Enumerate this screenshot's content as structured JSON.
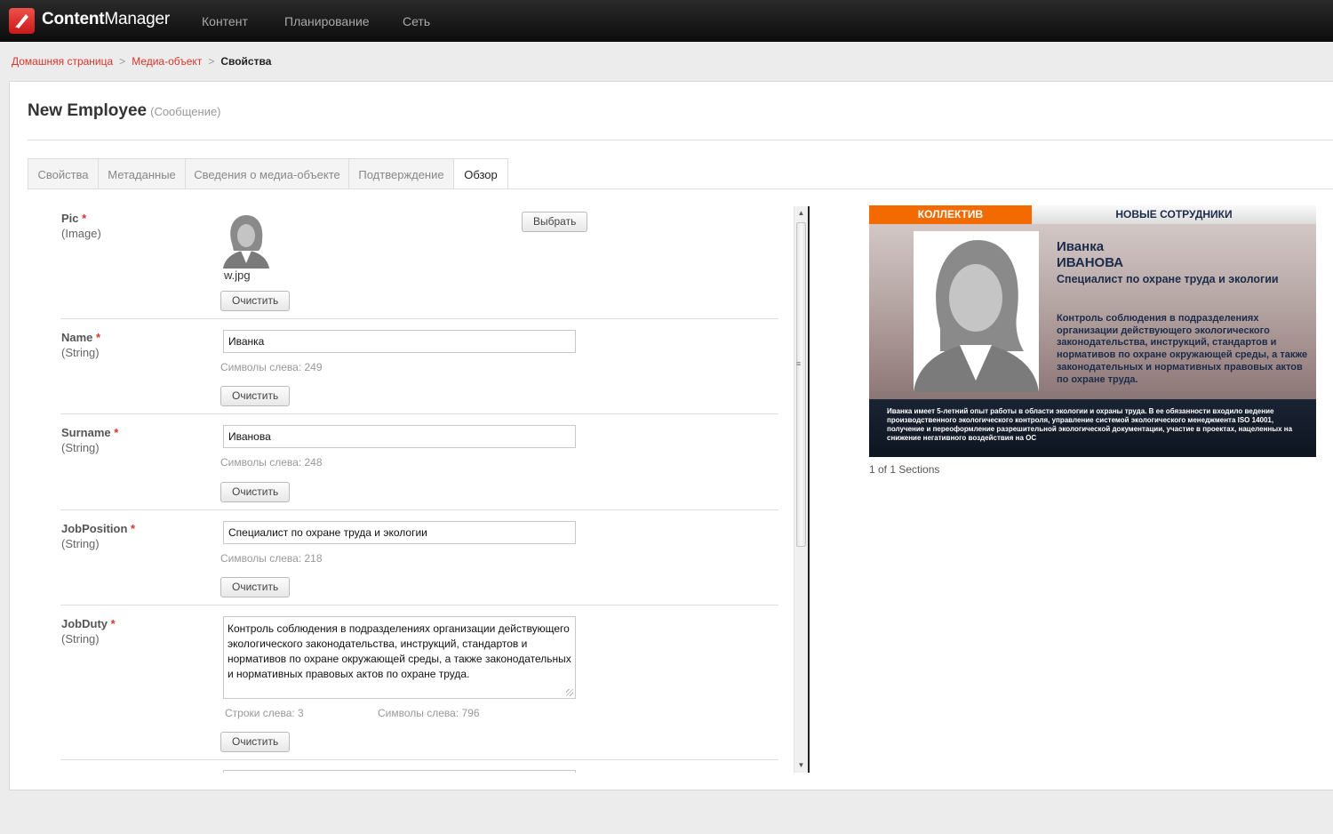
{
  "app": {
    "brand_main": "Content",
    "brand_rest": "Manager"
  },
  "nav": [
    {
      "label": "Контент"
    },
    {
      "label": "Планирование"
    },
    {
      "label": "Сеть"
    }
  ],
  "breadcrumb": {
    "home": "Домашняя страница",
    "media": "Медиа-объект",
    "current": "Свойства",
    "separator": ">"
  },
  "page": {
    "title": "New Employee",
    "subtitle": "(Сообщение)"
  },
  "tabs": [
    {
      "label": "Свойства",
      "active": false
    },
    {
      "label": "Метаданные",
      "active": false
    },
    {
      "label": "Сведения о медиа-объекте",
      "active": false
    },
    {
      "label": "Подтверждение",
      "active": false
    },
    {
      "label": "Обзор",
      "active": true
    }
  ],
  "form": {
    "required_mark": "*",
    "clear_label": "Очистить",
    "pic": {
      "name": "Pic",
      "type": "(Image)",
      "file": "w.jpg",
      "choose_label": "Выбрать",
      "avatar_icon": "person-silhouette-icon"
    },
    "name": {
      "name": "Name",
      "type": "(String)",
      "value": "Иванка",
      "hint": "Символы слева: 249"
    },
    "surname": {
      "name": "Surname",
      "type": "(String)",
      "value": "Иванова",
      "hint": "Символы слева: 248"
    },
    "job_position": {
      "name": "JobPosition",
      "type": "(String)",
      "value": "Специалист по охране труда и экологии",
      "hint": "Символы слева: 218"
    },
    "job_duty": {
      "name": "JobDuty",
      "type": "(String)",
      "value": "Контроль соблюдения в подразделениях организации действующего экологического законодательства, инструкций, стандартов и нормативов по охране окружающей среды, а также законодательных и нормативных правовых актов по охране труда.",
      "lines_hint": "Строки слева: 3",
      "chars_hint": "Символы слева: 796"
    }
  },
  "preview": {
    "tag": "КОЛЛЕКТИВ",
    "header": "НОВЫЕ СОТРУДНИКИ",
    "first_name": "Иванка",
    "last_name": "ИВАНОВА",
    "job": "Специалист по охране труда и экологии",
    "duty": "Контроль соблюдения в подразделениях организации действующего экологического законодательства, инструкций, стандартов и нормативов по охране окружающей среды, а также законодательных и нормативных правовых актов по охране труда.",
    "experience": "Иванка имеет 5-летний опыт работы в области экологии и охраны труда. В ее обязанности входило ведение производственного экологического контроля, управление системой экологического менеджмента ISO 14001, получение и переоформление разрешительной экологической документации, участие в проектах, нацеленных на снижение негативного воздействия на ОС",
    "sections": "1 of 1 Sections"
  },
  "colors": {
    "accent": "#d9342b",
    "orange": "#f26a00",
    "navy": "#1c2b4a"
  }
}
